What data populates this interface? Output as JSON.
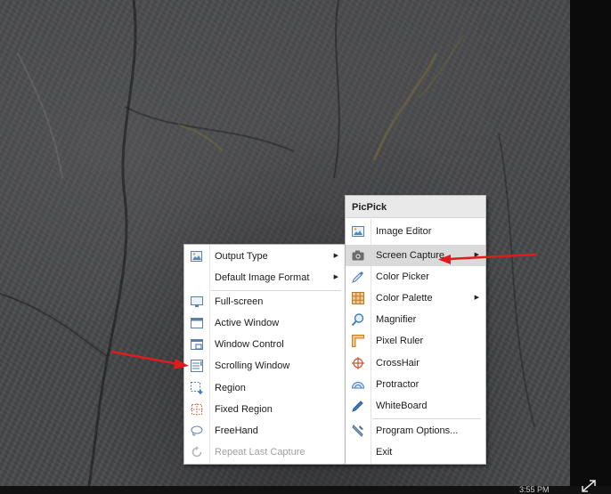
{
  "desktop": {
    "clock_text": "3:55 PM"
  },
  "main_menu": {
    "title": "PicPick",
    "items": [
      {
        "label": "Image Editor",
        "icon": "image-editor-icon"
      },
      {
        "label": "Screen Capture",
        "icon": "camera-icon",
        "has_submenu": true,
        "highlighted": true
      },
      {
        "label": "Color Picker",
        "icon": "eyedropper-icon"
      },
      {
        "label": "Color Palette",
        "icon": "palette-grid-icon",
        "has_submenu": true
      },
      {
        "label": "Magnifier",
        "icon": "magnifier-icon"
      },
      {
        "label": "Pixel Ruler",
        "icon": "ruler-icon"
      },
      {
        "label": "CrossHair",
        "icon": "crosshair-icon"
      },
      {
        "label": "Protractor",
        "icon": "protractor-icon"
      },
      {
        "label": "WhiteBoard",
        "icon": "pen-icon"
      },
      {
        "label": "Program Options...",
        "icon": "wrench-icon"
      },
      {
        "label": "Exit",
        "icon": ""
      }
    ]
  },
  "capture_menu": {
    "items": [
      {
        "label": "Output Type",
        "icon": "output-image-icon",
        "has_submenu": true
      },
      {
        "label": "Default Image Format",
        "icon": "",
        "has_submenu": true
      },
      {
        "label": "Full-screen",
        "icon": "monitor-icon"
      },
      {
        "label": "Active Window",
        "icon": "window-icon"
      },
      {
        "label": "Window Control",
        "icon": "window-control-icon"
      },
      {
        "label": "Scrolling Window",
        "icon": "scrolling-window-icon"
      },
      {
        "label": "Region",
        "icon": "region-icon"
      },
      {
        "label": "Fixed Region",
        "icon": "fixed-region-icon"
      },
      {
        "label": "FreeHand",
        "icon": "lasso-icon"
      },
      {
        "label": "Repeat Last Capture",
        "icon": "repeat-icon",
        "disabled": true
      }
    ]
  },
  "colors": {
    "annotation_arrow": "#e01b1b",
    "highlight": "#dadada"
  }
}
